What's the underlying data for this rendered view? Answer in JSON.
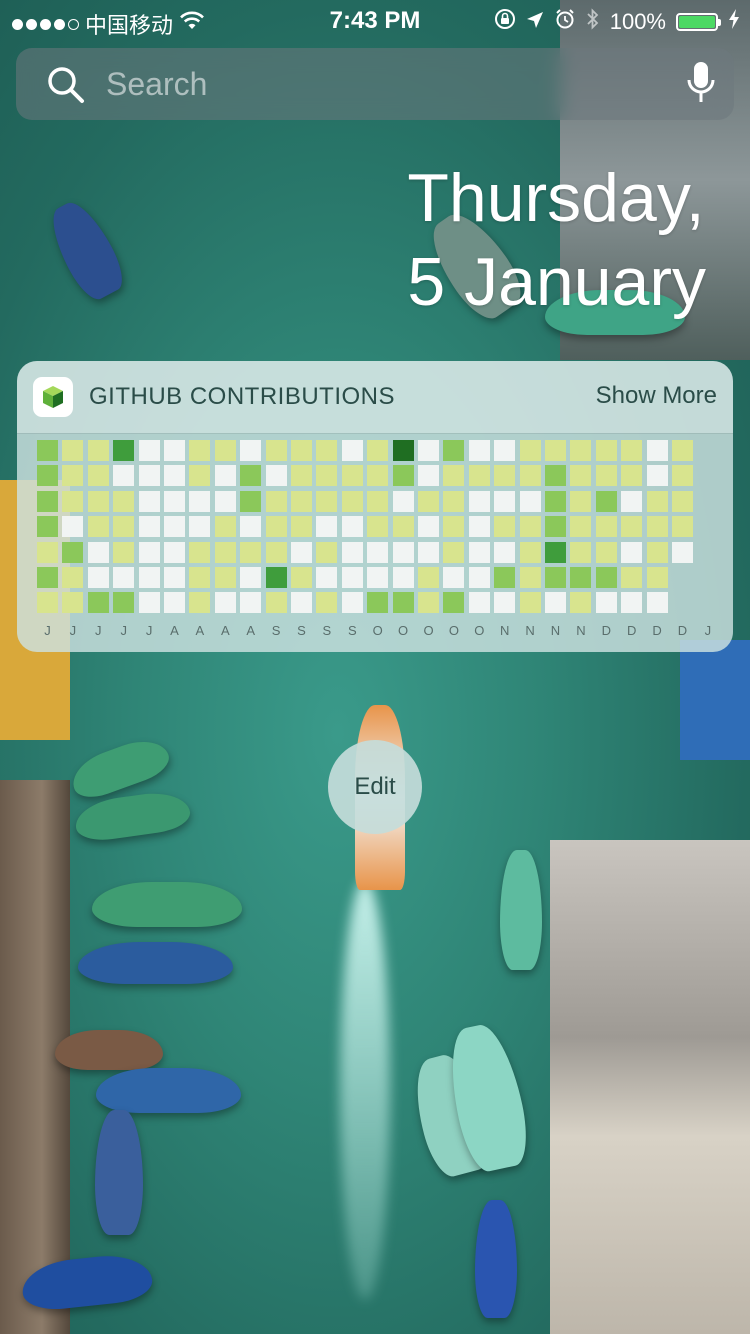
{
  "status_bar": {
    "carrier": "中国移动",
    "time": "7:43 PM",
    "battery_percent": "100%",
    "signal_bars": 4,
    "signal_total": 5
  },
  "search": {
    "placeholder": "Search"
  },
  "date": {
    "weekday": "Thursday,",
    "day_month": "5 January"
  },
  "widget": {
    "title": "GITHUB CONTRIBUTIONS",
    "show_more": "Show More",
    "colors": {
      "0": "#f1f4f3",
      "1": "#d8e48e",
      "2": "#8bc85a",
      "3": "#3f9d3c",
      "4": "#1f6e22"
    },
    "contributions": [
      [
        2,
        1,
        1,
        3,
        0,
        0,
        1,
        1,
        0,
        1,
        1,
        1,
        0,
        1,
        4,
        0,
        2,
        0,
        0,
        1,
        1,
        1,
        1,
        1,
        0,
        1
      ],
      [
        2,
        1,
        1,
        0,
        0,
        0,
        1,
        0,
        2,
        0,
        1,
        1,
        1,
        1,
        2,
        0,
        1,
        1,
        1,
        1,
        2,
        1,
        1,
        1,
        0,
        1
      ],
      [
        2,
        1,
        1,
        1,
        0,
        0,
        0,
        0,
        2,
        1,
        1,
        1,
        1,
        1,
        0,
        1,
        1,
        0,
        0,
        0,
        2,
        1,
        2,
        0,
        1,
        1
      ],
      [
        2,
        0,
        1,
        1,
        0,
        0,
        0,
        1,
        0,
        1,
        1,
        0,
        0,
        1,
        1,
        0,
        1,
        0,
        1,
        1,
        2,
        1,
        1,
        1,
        1,
        1
      ],
      [
        1,
        2,
        0,
        1,
        0,
        0,
        1,
        1,
        1,
        1,
        0,
        1,
        0,
        0,
        0,
        0,
        1,
        0,
        0,
        1,
        3,
        1,
        1,
        0,
        1,
        0
      ],
      [
        2,
        1,
        0,
        0,
        0,
        0,
        1,
        1,
        0,
        3,
        1,
        0,
        0,
        0,
        0,
        1,
        0,
        0,
        2,
        1,
        2,
        2,
        2,
        1,
        1
      ],
      [
        1,
        1,
        2,
        2,
        0,
        0,
        1,
        0,
        0,
        1,
        0,
        1,
        0,
        2,
        2,
        1,
        2,
        0,
        0,
        1,
        0,
        1,
        0,
        0,
        0
      ]
    ],
    "months": [
      "J",
      "J",
      "J",
      "J",
      "J",
      "A",
      "A",
      "A",
      "A",
      "S",
      "S",
      "S",
      "S",
      "O",
      "O",
      "O",
      "O",
      "O",
      "N",
      "N",
      "N",
      "N",
      "D",
      "D",
      "D",
      "D",
      "J"
    ]
  },
  "edit_button": {
    "label": "Edit"
  }
}
